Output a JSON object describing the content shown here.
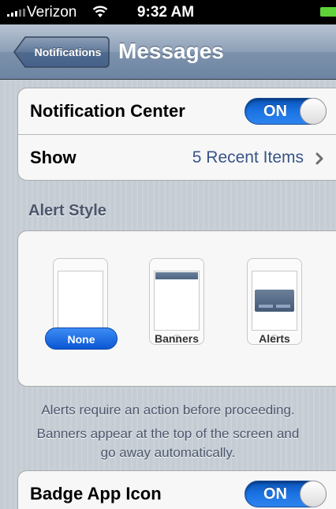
{
  "status_bar": {
    "carrier": "Verizon",
    "time": "9:32 AM",
    "icons": [
      "signal-icon",
      "wifi-icon",
      "battery-icon"
    ]
  },
  "nav": {
    "back_label": "Notifications",
    "title": "Messages"
  },
  "notification_center": {
    "label": "Notification Center",
    "toggle": "ON"
  },
  "show": {
    "label": "Show",
    "value": "5 Recent Items"
  },
  "alert_style": {
    "header": "Alert Style",
    "options": [
      {
        "label": "None",
        "selected": true,
        "preview": "blank"
      },
      {
        "label": "Banners",
        "selected": false,
        "preview": "banner"
      },
      {
        "label": "Alerts",
        "selected": false,
        "preview": "alert"
      }
    ],
    "footer": [
      "Alerts require an action before proceeding.",
      "Banners appear at the top of the screen and",
      "go away automatically."
    ]
  },
  "badge_app_icon": {
    "label": "Badge App Icon",
    "toggle": "ON"
  },
  "colors": {
    "accent": "#1a73e3",
    "value_text": "#385487",
    "background": "#c5ccd4"
  }
}
